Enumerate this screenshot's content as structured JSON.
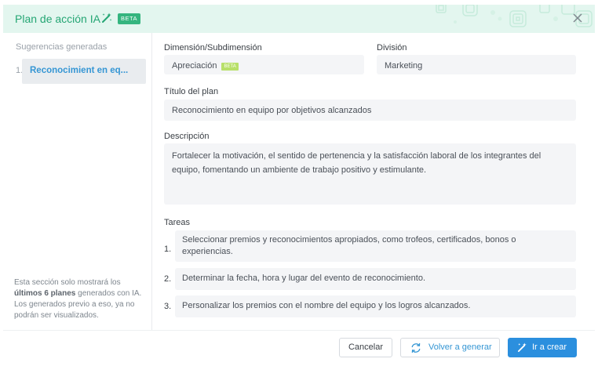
{
  "header": {
    "title": "Plan de acción IA",
    "badge": "BETA",
    "icons": [
      "magic-wand-icon",
      "close-icon"
    ],
    "accent": "#25a674"
  },
  "sidebar": {
    "heading": "Sugerencias generadas",
    "items": [
      {
        "number": "1.",
        "label": "Reconocimient en eq..."
      }
    ],
    "note": {
      "part1": "Esta sección solo mostrará los ",
      "bold": "últimos 6 planes",
      "part2": " generados con IA. Los generados previo a eso, ya no podrán ser visualizados."
    }
  },
  "main": {
    "dimension": {
      "label": "Dimensión/Subdimensión",
      "value": "Apreciación",
      "badge": "BETA"
    },
    "division": {
      "label": "División",
      "value": "Marketing"
    },
    "title": {
      "label": "Título del plan",
      "value": "Reconocimiento en equipo por objetivos alcanzados"
    },
    "description": {
      "label": "Descripción",
      "value": "Fortalecer la motivación, el sentido de pertenencia y la satisfacción laboral de los integrantes del equipo, fomentando un ambiente de trabajo positivo y estimulante."
    },
    "tasks": {
      "label": "Tareas",
      "items": [
        {
          "number": "1.",
          "text": "Seleccionar premios y reconocimientos apropiados, como trofeos, certificados, bonos o experiencias."
        },
        {
          "number": "2.",
          "text": "Determinar la fecha, hora y lugar del evento de reconocimiento."
        },
        {
          "number": "3.",
          "text": "Personalizar los premios con el nombre del equipo y los logros alcanzados."
        }
      ]
    }
  },
  "footer": {
    "cancel_label": "Cancelar",
    "regenerate_label": "Volver a generar",
    "create_label": "Ir a crear",
    "primary_color": "#2b8fde"
  }
}
